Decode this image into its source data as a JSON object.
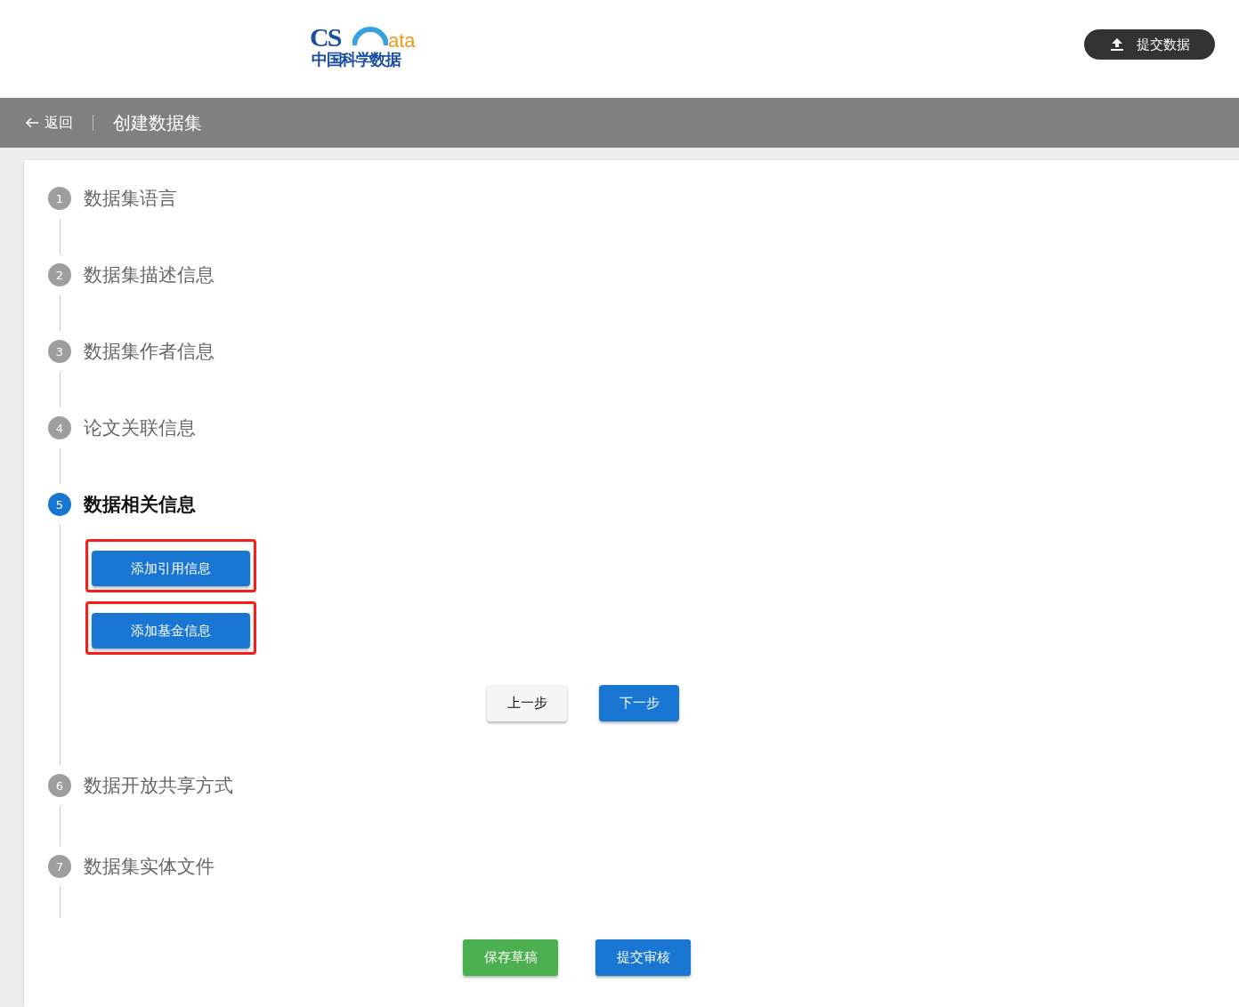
{
  "header": {
    "logo": {
      "mark": "CS",
      "suffix": "ata",
      "subtitle": "中国科学数据"
    },
    "submit_button": "提交数据"
  },
  "nav": {
    "back": "返回",
    "title": "创建数据集"
  },
  "steps": [
    {
      "number": "1",
      "label": "数据集语言",
      "selected": false
    },
    {
      "number": "2",
      "label": "数据集描述信息",
      "selected": false
    },
    {
      "number": "3",
      "label": "数据集作者信息",
      "selected": false
    },
    {
      "number": "4",
      "label": "论文关联信息",
      "selected": false
    },
    {
      "number": "5",
      "label": "数据相关信息",
      "selected": true,
      "actions": [
        {
          "label": "添加引用信息",
          "highlighted": true
        },
        {
          "label": "添加基金信息",
          "highlighted": true
        }
      ],
      "prev": "上一步",
      "next": "下一步"
    },
    {
      "number": "6",
      "label": "数据开放共享方式",
      "selected": false
    },
    {
      "number": "7",
      "label": "数据集实体文件",
      "selected": false
    }
  ],
  "footer": {
    "save_draft": "保存草稿",
    "submit_review": "提交审核"
  }
}
